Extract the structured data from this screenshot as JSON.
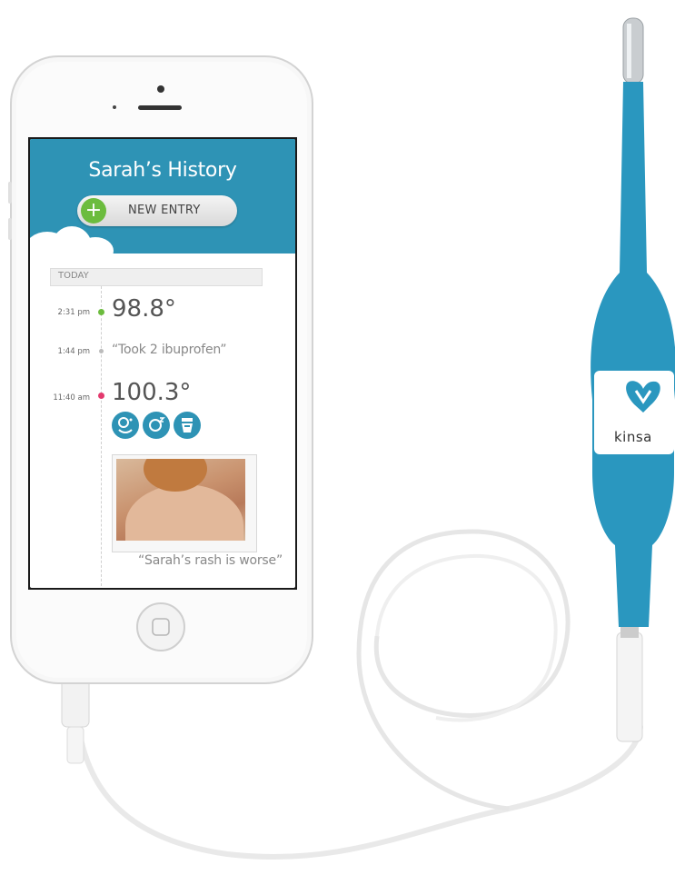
{
  "screen": {
    "title": "Sarah’s History",
    "new_entry_label": "NEW ENTRY",
    "plus_symbol": "+",
    "section_label": "TODAY",
    "entries": [
      {
        "time": "2:31 pm",
        "value": "98.8°",
        "dot_color": "#6cbc3e"
      },
      {
        "time": "1:44 pm",
        "value": "“Took 2 ibuprofen”",
        "dot_color": "#bbbbbb"
      },
      {
        "time": "11:40 am",
        "value": "100.3°",
        "dot_color": "#e33a6e"
      }
    ],
    "symptom_icons": [
      "baby-cough-icon",
      "baby-sleep-icon",
      "diaper-icon"
    ],
    "photo_icon": "rash-photo",
    "photo_caption": "“Sarah’s rash is worse”",
    "accent_color": "#2e93b5"
  },
  "device": {
    "brand": "kinsa",
    "logo_icon": "heart-v-logo",
    "color": "#2a97bf"
  }
}
